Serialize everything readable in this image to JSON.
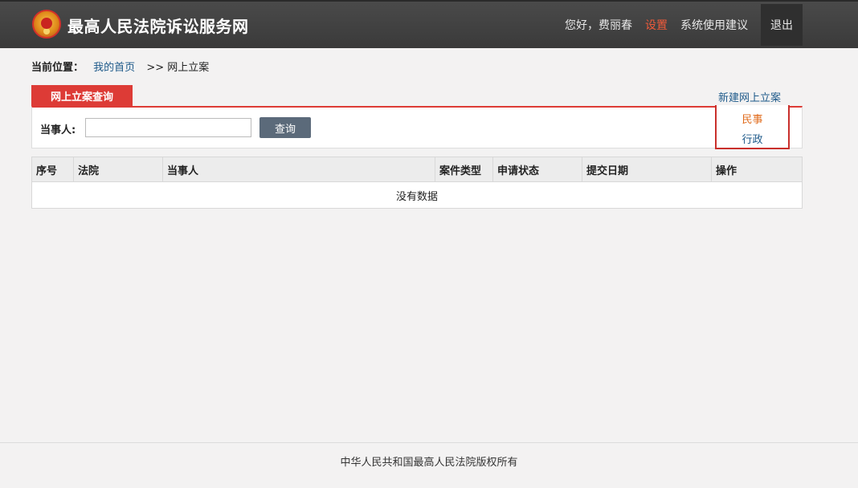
{
  "header": {
    "site_title": "最高人民法院诉讼服务网",
    "greeting": "您好，费丽春",
    "settings": "设置",
    "feedback": "系统使用建议",
    "logout": "退出",
    "accent_color": "#f05a3a"
  },
  "breadcrumb": {
    "label": "当前位置：",
    "home": "我的首页",
    "current": ">> 网上立案"
  },
  "tab": {
    "active_label": "网上立案查询",
    "color": "#dd3b36"
  },
  "new_case": {
    "link_label": "新建网上立案",
    "options": [
      "民事",
      "行政"
    ]
  },
  "search": {
    "label": "当事人:",
    "input_value": "",
    "button_label": "查询"
  },
  "table": {
    "columns": [
      "序号",
      "法院",
      "当事人",
      "案件类型",
      "申请状态",
      "提交日期",
      "操作"
    ],
    "empty_text": "没有数据"
  },
  "footer": {
    "text": "中华人民共和国最高人民法院版权所有"
  }
}
